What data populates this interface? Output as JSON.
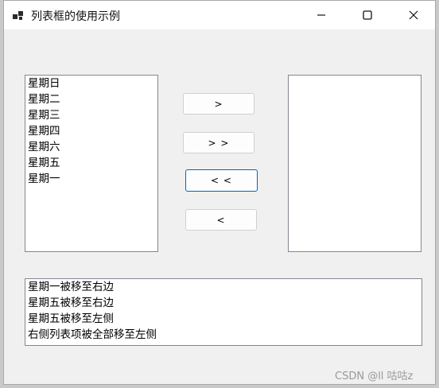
{
  "window": {
    "title": "列表框的使用示例"
  },
  "left_list": {
    "items": [
      "星期日",
      "星期二",
      "星期三",
      "星期四",
      "星期六",
      "星期五",
      "星期一"
    ]
  },
  "right_list": {
    "items": []
  },
  "buttons": {
    "move_one_right": ">",
    "move_all_right": "> >",
    "move_all_left": "< <",
    "move_one_left": "<"
  },
  "log_list": {
    "items": [
      "星期一被移至右边",
      "星期五被移至右边",
      "星期五被移至左侧",
      "右侧列表项被全部移至左侧"
    ]
  },
  "watermark": "CSDN @ll 咕咕z",
  "colors": {
    "focus_border": "#0067c0",
    "window_bg": "#f0f0f0",
    "titlebar_bg": "#ffffff"
  }
}
